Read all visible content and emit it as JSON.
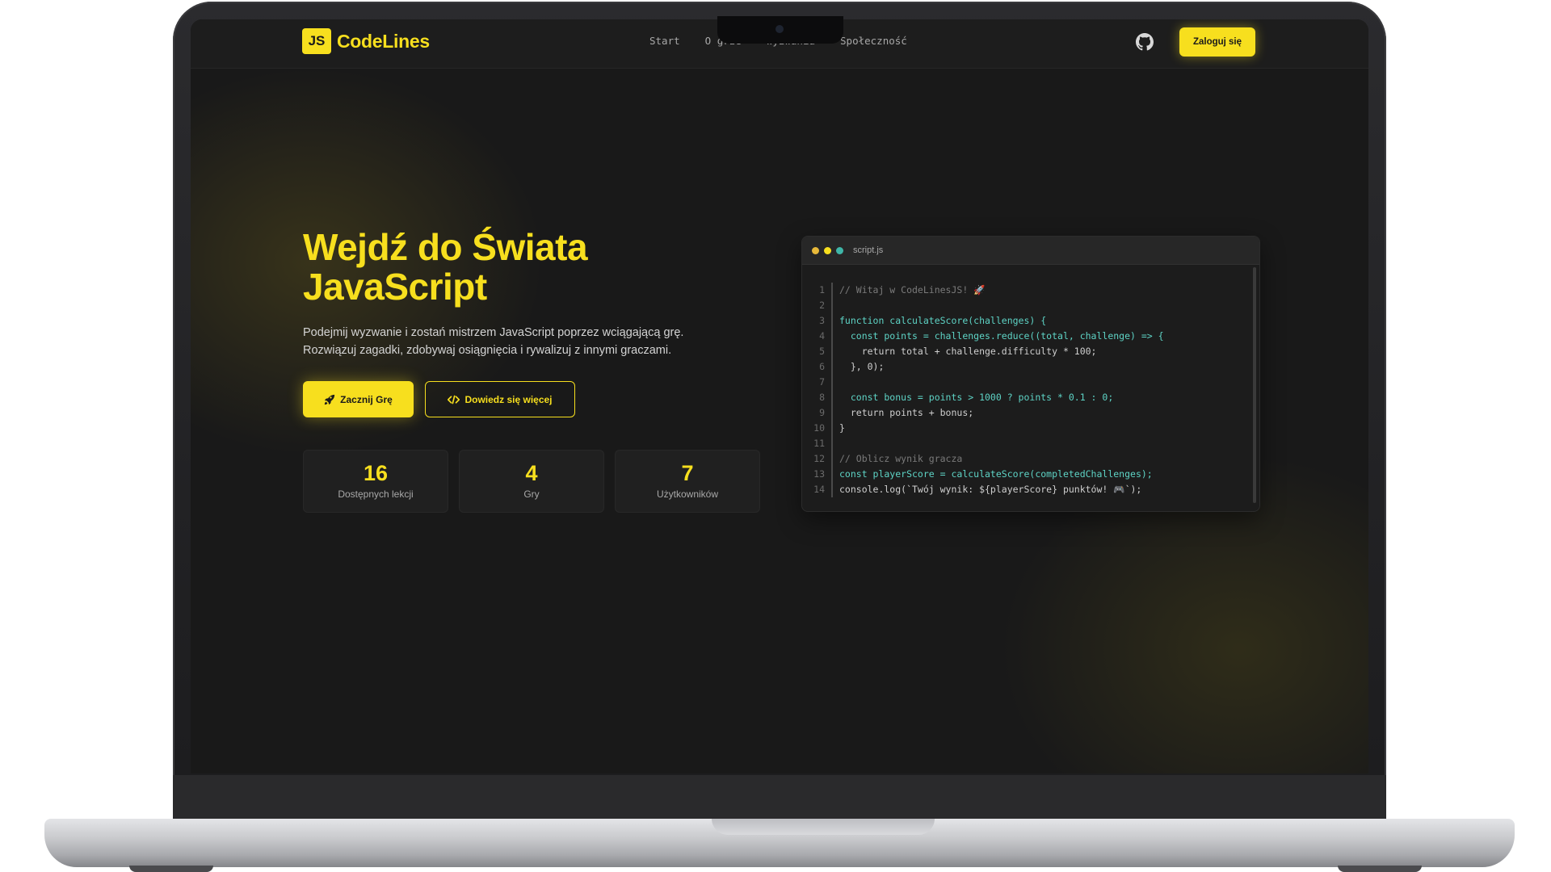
{
  "nav": {
    "logo_badge": "JS",
    "logo_text": "CodeLines",
    "links": [
      "Start",
      "O grze",
      "Wyzwania",
      "Społeczność"
    ],
    "login_label": "Zaloguj się"
  },
  "hero": {
    "title_line1": "Wejdź do Świata",
    "title_line2": "JavaScript",
    "desc_line1": "Podejmij wyzwanie i zostań mistrzem JavaScript poprzez wciągającą grę.",
    "desc_line2": "Rozwiązuj zagadki, zdobywaj osiągnięcia i rywalizuj z innymi graczami.",
    "primary_label": "Zacznij Grę",
    "secondary_label": "Dowiedz się więcej"
  },
  "stats": [
    {
      "value": "16",
      "label": "Dostępnych lekcji"
    },
    {
      "value": "4",
      "label": "Gry"
    },
    {
      "value": "7",
      "label": "Użytkowników"
    }
  ],
  "editor": {
    "filename": "script.js",
    "dot_colors": [
      "#e8b93a",
      "#f7df1e",
      "#3fb6a8"
    ],
    "lines": [
      {
        "n": "1",
        "text": "// Witaj w CodeLinesJS! 🚀",
        "type": "comment"
      },
      {
        "n": "2",
        "text": "",
        "type": "code"
      },
      {
        "n": "3",
        "text": "function calculateScore(challenges) {",
        "type": "code"
      },
      {
        "n": "4",
        "text": "  const points = challenges.reduce((total, challenge) => {",
        "type": "code"
      },
      {
        "n": "5",
        "text": "    return total + challenge.difficulty * 100;",
        "type": "plain"
      },
      {
        "n": "6",
        "text": "  }, 0);",
        "type": "plain"
      },
      {
        "n": "7",
        "text": "",
        "type": "code"
      },
      {
        "n": "8",
        "text": "  const bonus = points > 1000 ? points * 0.1 : 0;",
        "type": "code"
      },
      {
        "n": "9",
        "text": "  return points + bonus;",
        "type": "plain"
      },
      {
        "n": "10",
        "text": "}",
        "type": "plain"
      },
      {
        "n": "11",
        "text": "",
        "type": "code"
      },
      {
        "n": "12",
        "text": "// Oblicz wynik gracza",
        "type": "comment"
      },
      {
        "n": "13",
        "text": "const playerScore = calculateScore(completedChallenges);",
        "type": "code"
      },
      {
        "n": "14",
        "text": "console.log(`Twój wynik: ${playerScore} punktów! 🎮`);",
        "type": "plain"
      }
    ]
  },
  "colors": {
    "accent": "#f7df1e",
    "background": "#191919",
    "code_keyword": "#5ed4c6"
  }
}
